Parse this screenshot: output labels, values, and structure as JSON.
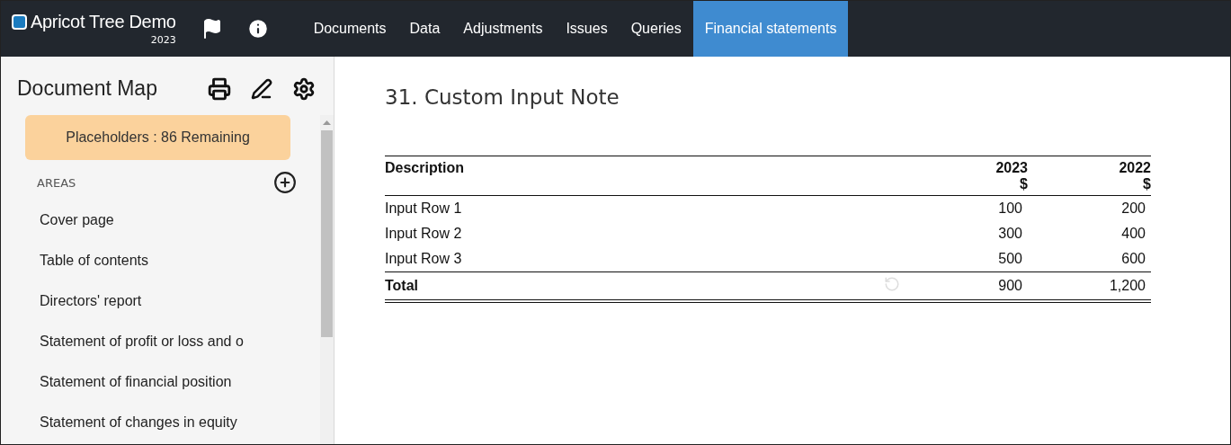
{
  "app": {
    "title": "Apricot Tree Demo",
    "year": "2023"
  },
  "nav": [
    {
      "label": "Documents",
      "selected": false
    },
    {
      "label": "Data",
      "selected": false
    },
    {
      "label": "Adjustments",
      "selected": false
    },
    {
      "label": "Issues",
      "selected": false
    },
    {
      "label": "Queries",
      "selected": false
    },
    {
      "label": "Financial statements",
      "selected": true
    }
  ],
  "sidebar": {
    "title": "Document Map",
    "placeholders": "Placeholders : 86 Remaining",
    "section": "AREAS",
    "items": [
      "Cover page",
      "Table of contents",
      "Directors' report",
      "Statement of profit or loss and o",
      "Statement of financial position",
      "Statement of changes in equity"
    ]
  },
  "note": {
    "number": "31.",
    "title": "Custom Input Note",
    "columns": [
      {
        "label": "Description"
      },
      {
        "label": "2023",
        "unit": "$"
      },
      {
        "label": "2022",
        "unit": "$"
      }
    ],
    "rows": [
      {
        "kind": "input",
        "cells": [
          "Input Row 1",
          "100",
          "200"
        ]
      },
      {
        "kind": "input",
        "cells": [
          "Input Row 2",
          "300",
          "400"
        ]
      },
      {
        "kind": "input",
        "cells": [
          "Input Row 3",
          "500",
          "600"
        ]
      },
      {
        "kind": "total",
        "cells": [
          "Total",
          "900",
          "1,200"
        ]
      }
    ]
  }
}
